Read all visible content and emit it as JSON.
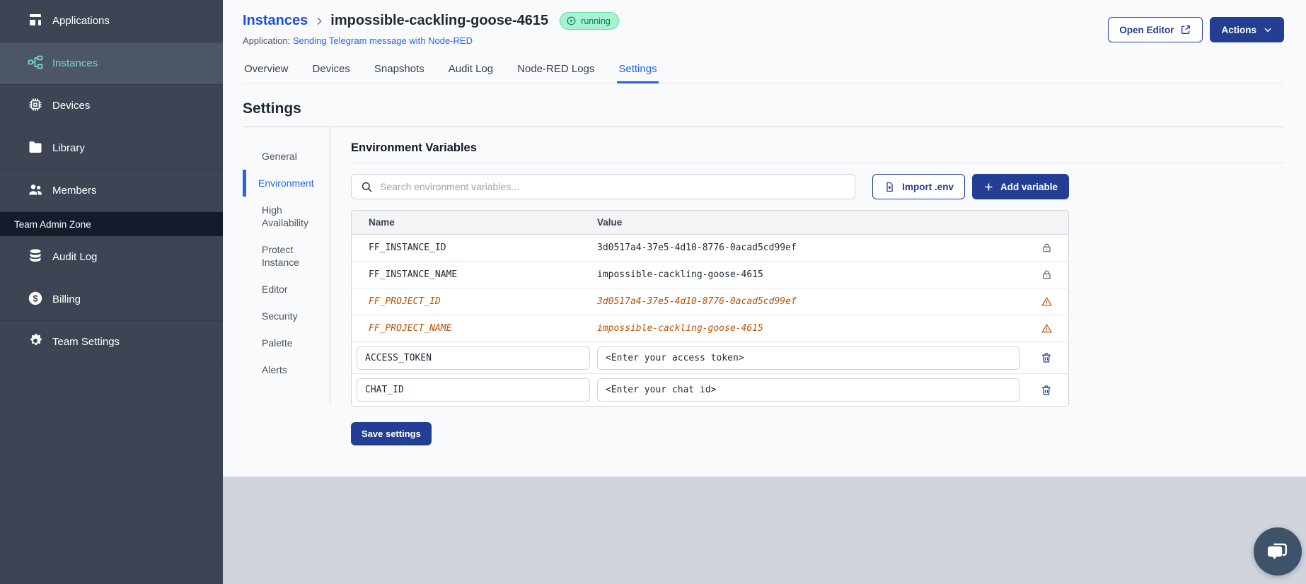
{
  "colors": {
    "accent_blue": "#2563eb",
    "navy_button": "#233e93",
    "sidebar_teal": "#7ed3d3",
    "deprecated_orange": "#b45309",
    "badge_green_bg": "#a7f3d0",
    "badge_green_text": "#047857",
    "sidebar_bg": "#3d4554",
    "footer_gray": "#d0d4dd"
  },
  "sidebar": {
    "items": [
      {
        "label": "Applications",
        "icon": "applications-icon"
      },
      {
        "label": "Instances",
        "icon": "instances-icon"
      },
      {
        "label": "Devices",
        "icon": "devices-icon"
      },
      {
        "label": "Library",
        "icon": "library-icon"
      },
      {
        "label": "Members",
        "icon": "members-icon"
      }
    ],
    "active_item": "Instances",
    "admin_section_label": "Team Admin Zone",
    "admin_items": [
      {
        "label": "Audit Log",
        "icon": "audit-log-icon"
      },
      {
        "label": "Billing",
        "icon": "billing-icon"
      },
      {
        "label": "Team Settings",
        "icon": "team-settings-icon"
      }
    ]
  },
  "header": {
    "breadcrumb": "Instances",
    "instance_name": "impossible-cackling-goose-4615",
    "status_badge": "running",
    "application_label": "Application:",
    "application_name": "Sending Telegram message with Node-RED",
    "open_editor_button": "Open Editor",
    "actions_button": "Actions"
  },
  "tabs": {
    "items": [
      "Overview",
      "Devices",
      "Snapshots",
      "Audit Log",
      "Node-RED Logs",
      "Settings"
    ],
    "active": "Settings"
  },
  "settings": {
    "page_title": "Settings",
    "nav_items": [
      "General",
      "Environment",
      "High Availability",
      "Protect Instance",
      "Editor",
      "Security",
      "Palette",
      "Alerts"
    ],
    "active_nav": "Environment",
    "env": {
      "title": "Environment Variables",
      "search_placeholder": "Search environment variables...",
      "import_button": "Import .env",
      "add_button": "Add variable",
      "columns": {
        "name": "Name",
        "value": "Value"
      },
      "rows": [
        {
          "name": "FF_INSTANCE_ID",
          "value": "3d0517a4-37e5-4d10-8776-0acad5cd99ef",
          "state": "locked",
          "icon": "lock-icon"
        },
        {
          "name": "FF_INSTANCE_NAME",
          "value": "impossible-cackling-goose-4615",
          "state": "locked",
          "icon": "lock-icon"
        },
        {
          "name": "FF_PROJECT_ID",
          "value": "3d0517a4-37e5-4d10-8776-0acad5cd99ef",
          "state": "deprecated",
          "icon": "warning-icon"
        },
        {
          "name": "FF_PROJECT_NAME",
          "value": "impossible-cackling-goose-4615",
          "state": "deprecated",
          "icon": "warning-icon"
        },
        {
          "name": "ACCESS_TOKEN",
          "value": "<Enter your access token>",
          "state": "editable",
          "icon": "trash-icon"
        },
        {
          "name": "CHAT_ID",
          "value": "<Enter your chat id>",
          "state": "editable",
          "icon": "trash-icon"
        }
      ],
      "save_button": "Save settings"
    }
  },
  "chat_widget": {
    "icon": "chat-icon"
  }
}
